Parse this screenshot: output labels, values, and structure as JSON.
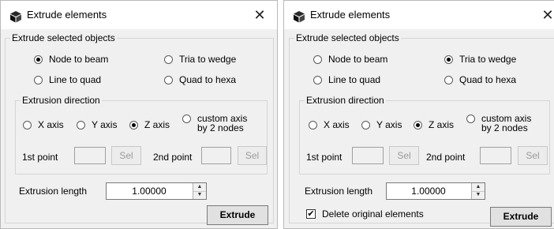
{
  "dialogs": [
    {
      "title": "Extrude elements",
      "close_glyph": "✕",
      "icons": {
        "app": "cube-icon",
        "close": "close-icon"
      },
      "selected_objects": {
        "legend": "Extrude selected objects",
        "options": [
          {
            "label": "Node to beam",
            "selected": true
          },
          {
            "label": "Tria to wedge",
            "selected": false
          },
          {
            "label": "Line to quad",
            "selected": false
          },
          {
            "label": "Quad to hexa",
            "selected": false
          }
        ]
      },
      "direction": {
        "legend": "Extrusion direction",
        "x_label": "X axis",
        "y_label": "Y axis",
        "z_label": "Z axis",
        "custom_label_line1": "custom axis",
        "custom_label_line2": "by 2 nodes",
        "selected": "Z axis",
        "first_point_label": "1st point",
        "second_point_label": "2nd point",
        "sel_label": "Sel"
      },
      "length_label": "Extrusion length",
      "length_value": "1.00000",
      "extrude_label": "Extrude"
    },
    {
      "title": "Extrude elements",
      "close_glyph": "✕",
      "icons": {
        "app": "cube-icon",
        "close": "close-icon"
      },
      "selected_objects": {
        "legend": "Extrude selected objects",
        "options": [
          {
            "label": "Node to beam",
            "selected": false
          },
          {
            "label": "Tria to wedge",
            "selected": true
          },
          {
            "label": "Line to quad",
            "selected": false
          },
          {
            "label": "Quad to hexa",
            "selected": false
          }
        ]
      },
      "direction": {
        "legend": "Extrusion direction",
        "x_label": "X axis",
        "y_label": "Y axis",
        "z_label": "Z axis",
        "custom_label_line1": "custom axis",
        "custom_label_line2": "by 2 nodes",
        "selected": "Z axis",
        "first_point_label": "1st point",
        "second_point_label": "2nd point",
        "sel_label": "Sel"
      },
      "length_label": "Extrusion length",
      "length_value": "1.00000",
      "delete_original": {
        "label": "Delete original elements",
        "checked": true
      },
      "extrude_label": "Extrude"
    }
  ]
}
